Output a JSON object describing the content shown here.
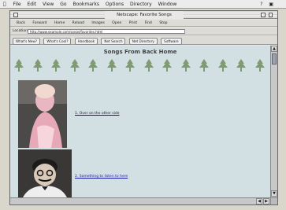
{
  "menubar": {
    "items": [
      "File",
      "Edit",
      "View",
      "Go",
      "Bookmarks",
      "Options",
      "Directory",
      "Window"
    ],
    "right_icons": [
      "help-icon",
      "application-icon"
    ]
  },
  "window": {
    "title": "Netscape: Favorite Songs"
  },
  "toolbar": {
    "buttons": [
      "Back",
      "Forward",
      "Home",
      "Reload",
      "Images",
      "Open",
      "Print",
      "Find",
      "Stop"
    ]
  },
  "location": {
    "label": "Location:",
    "value": "http://www.example.com/songs/favorites.html"
  },
  "directory_buttons": [
    "What's New?",
    "What's Cool?",
    "Handbook",
    "Net Search",
    "Net Directory",
    "Software"
  ],
  "content": {
    "heading": "Songs From Back Home",
    "tree_count": 14,
    "link1": "1. Over on the other side",
    "link2": "2. Something to listen to here"
  },
  "colors": {
    "page_background": "#d3e0e3",
    "tree_green": "#7f9a70",
    "link_color": "#1a1aa0"
  }
}
